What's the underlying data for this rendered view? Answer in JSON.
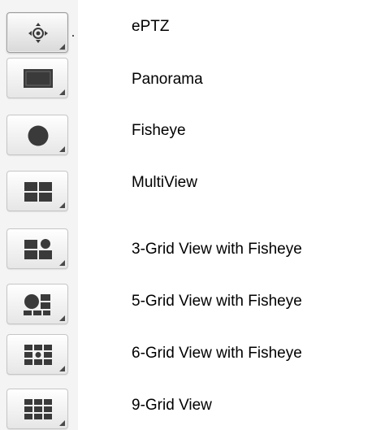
{
  "view_modes": [
    {
      "label": "ePTZ",
      "icon": "eptz-joystick-icon",
      "selected": true
    },
    {
      "label": "Panorama",
      "icon": "panorama-icon",
      "selected": false
    },
    {
      "label": "Fisheye",
      "icon": "fisheye-icon",
      "selected": false
    },
    {
      "label": "MultiView",
      "icon": "multiview-icon",
      "selected": false
    },
    {
      "label": "3-Grid View with Fisheye",
      "icon": "grid-3-fisheye-icon",
      "selected": false
    },
    {
      "label": "5-Grid View with Fisheye",
      "icon": "grid-5-fisheye-icon",
      "selected": false
    },
    {
      "label": "6-Grid View with Fisheye",
      "icon": "grid-6-fisheye-icon",
      "selected": false
    },
    {
      "label": "9-Grid View",
      "icon": "grid-9-icon",
      "selected": false
    }
  ],
  "colors": {
    "icon_fill": "#3a3a3a",
    "button_border": "#c6c6c6",
    "strip_background": "#f4f4f4",
    "label_text": "#000000"
  }
}
